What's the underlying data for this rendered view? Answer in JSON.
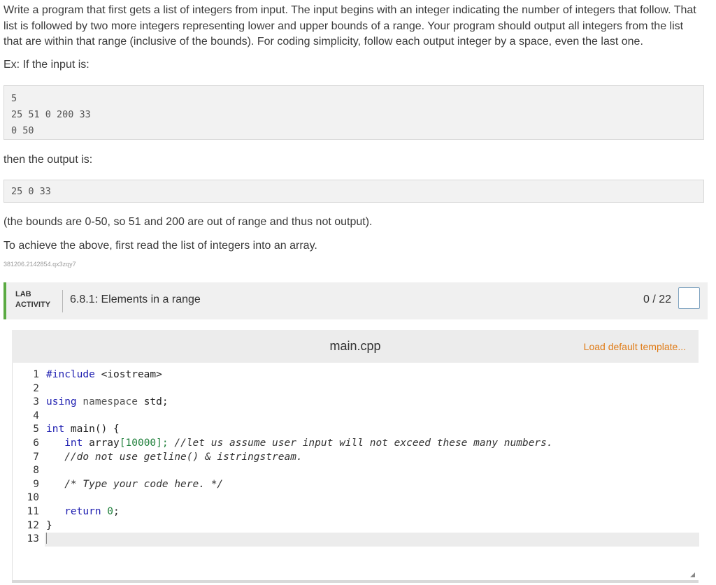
{
  "problem": {
    "paragraph1": "Write a program that first gets a list of integers from input. The input begins with an integer indicating the number of integers that follow. That list is followed by two more integers representing lower and upper bounds of a range. Your program should output all integers from the list that are within that range (inclusive of the bounds). For coding simplicity, follow each output integer by a space, even the last one.",
    "example_intro": "Ex: If the input is:",
    "input_lines": [
      "5",
      "25 51 0 200 33",
      "0 50"
    ],
    "output_intro": "then the output is:",
    "output_line": "25 0 33",
    "note": "(the bounds are 0-50, so 51 and 200 are out of range and thus not output).",
    "instruction": "To achieve the above, first read the list of integers into an array.",
    "meta_id": "381206.2142854.qx3zqy7"
  },
  "lab": {
    "tag_line1": "LAB",
    "tag_line2": "ACTIVITY",
    "title": "6.8.1: Elements in a range",
    "score": "0 / 22"
  },
  "editor": {
    "filename": "main.cpp",
    "load_template": "Load default template...",
    "line_numbers": [
      "1",
      "2",
      "3",
      "4",
      "5",
      "6",
      "7",
      "8",
      "9",
      "10",
      "11",
      "12",
      "13"
    ],
    "code": {
      "l1_directive": "#include",
      "l1_header": " <iostream>",
      "l3_using": "using",
      "l3_namespace": " namespace",
      "l3_std": " std;",
      "l5_int": "int",
      "l5_main": " main() {",
      "l6_int": "   int",
      "l6_array": " array",
      "l6_open": "[",
      "l6_num": "10000",
      "l6_close": "];",
      "l6_comment": " //let us assume user input will not exceed these many numbers.",
      "l7_comment": "   //do not use getline() & istringstream.",
      "l9_comment": "   /* Type your code here. */",
      "l11_return": "   return",
      "l11_num": " 0",
      "l11_semi": ";",
      "l12_brace": "}"
    }
  }
}
